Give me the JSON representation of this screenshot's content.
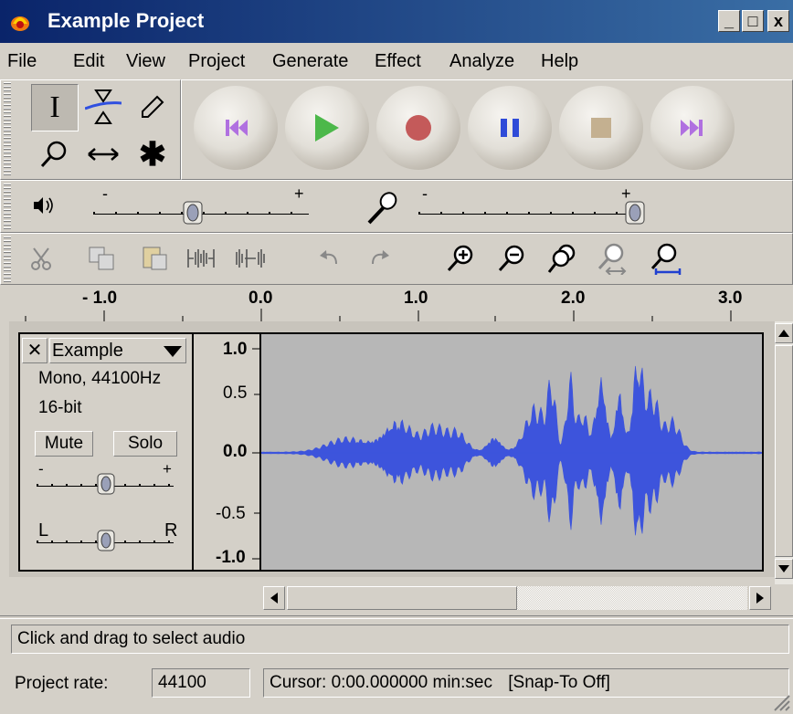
{
  "window": {
    "title": "Example Project",
    "minimize_label": "_",
    "maximize_label": "□",
    "close_label": "x"
  },
  "menu": [
    "File",
    "Edit",
    "View",
    "Project",
    "Generate",
    "Effect",
    "Analyze",
    "Help"
  ],
  "tools": {
    "selection_label": "I",
    "multi_tool_label": "✱"
  },
  "mixer": {
    "minus": "-",
    "plus": "+"
  },
  "ruler": {
    "ticks": [
      "- 1.0",
      "0.0",
      "1.0",
      "2.0",
      "3.0"
    ]
  },
  "track": {
    "close_label": "✕",
    "name": "Example",
    "info_rate": "Mono, 44100Hz",
    "info_bits": "16-bit",
    "mute_label": "Mute",
    "solo_label": "Solo",
    "gain_minus": "-",
    "gain_plus": "+",
    "pan_left": "L",
    "pan_right": "R",
    "gain_level": 0.5,
    "pan_level": 0.5,
    "scale": [
      "1.0",
      "0.5",
      "0.0",
      "-0.5",
      "-1.0"
    ]
  },
  "status": {
    "message": "Click and drag to select audio",
    "rate_label": "Project rate:",
    "rate_value": "44100",
    "cursor_text": "Cursor: 0:00.000000 min:sec",
    "snap_text": "[Snap-To Off]"
  },
  "colors": {
    "waveform": "#3d54dc",
    "waveform_bg": "#b7b7b7",
    "play_green": "#4cb84a",
    "record_red": "#c45a5a",
    "pause_blue": "#2f4bd8"
  }
}
